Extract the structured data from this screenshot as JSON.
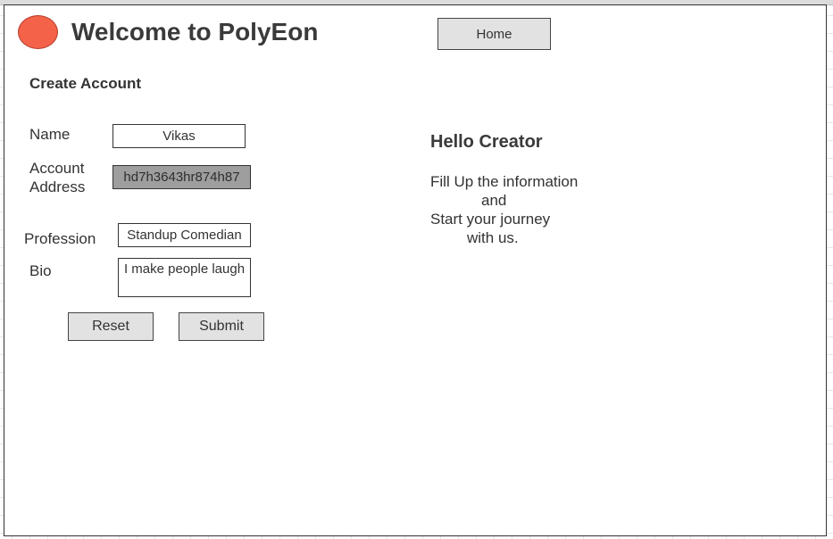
{
  "header": {
    "title": "Welcome to PolyEon",
    "home_label": "Home",
    "logo_color": "#f5624a"
  },
  "form": {
    "section_title": "Create Account",
    "name_label": "Name",
    "name_value": "Vikas",
    "account_label": "Account Address",
    "account_value": "hd7h3643hr874h87",
    "profession_label": "Profession",
    "profession_value": "Standup Comedian",
    "bio_label": "Bio",
    "bio_value": "I make people laugh",
    "reset_label": "Reset",
    "submit_label": "Submit"
  },
  "side": {
    "heading": "Hello Creator",
    "lines": [
      "Fill Up the information",
      "and",
      "Start your journey",
      "with us."
    ]
  }
}
